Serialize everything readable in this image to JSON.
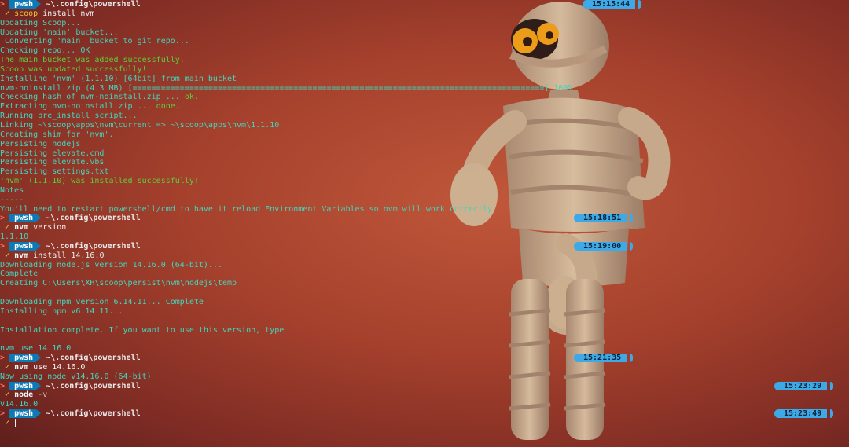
{
  "terminal": {
    "prompt_arrow": ">",
    "prompt_shell": "pwsh",
    "prompt_path": "~\\.config\\powershell",
    "check_mark": "✓",
    "blocks": [
      {
        "time": "15:15:44",
        "command": [
          {
            "text": "scoop",
            "cls": "c-yellow"
          },
          {
            "text": " install nvm",
            "cls": "c-white"
          }
        ],
        "output": [
          [
            {
              "text": "Updating Scoop...",
              "cls": "c-teal"
            }
          ],
          [
            {
              "text": "Updating 'main' bucket...",
              "cls": "c-teal"
            }
          ],
          [
            {
              "text": " Converting 'main' bucket to git repo...",
              "cls": "c-teal"
            }
          ],
          [
            {
              "text": "Checking repo... OK",
              "cls": "c-teal"
            }
          ],
          [
            {
              "text": "The main bucket was added successfully.",
              "cls": "c-green"
            }
          ],
          [
            {
              "text": "Scoop was updated successfully!",
              "cls": "c-green"
            }
          ],
          [
            {
              "text": "Installing 'nvm' (1.1.10) [64bit] from main bucket",
              "cls": "c-teal"
            }
          ],
          [
            {
              "text": "nvm-noinstall.zip (4.3 MB) [=======================================================================================] 100%",
              "cls": "c-teal"
            }
          ],
          [
            {
              "text": "Checking hash of nvm-noinstall.zip ... ",
              "cls": "c-teal"
            },
            {
              "text": "ok.",
              "cls": "c-green"
            }
          ],
          [
            {
              "text": "Extracting nvm-noinstall.zip ... ",
              "cls": "c-teal"
            },
            {
              "text": "done.",
              "cls": "c-green"
            }
          ],
          [
            {
              "text": "Running pre_install script...",
              "cls": "c-teal"
            }
          ],
          [
            {
              "text": "Linking ~\\scoop\\apps\\nvm\\current => ~\\scoop\\apps\\nvm\\1.1.10",
              "cls": "c-teal"
            }
          ],
          [
            {
              "text": "Creating shim for 'nvm'.",
              "cls": "c-teal"
            }
          ],
          [
            {
              "text": "Persisting nodejs",
              "cls": "c-teal"
            }
          ],
          [
            {
              "text": "Persisting elevate.cmd",
              "cls": "c-teal"
            }
          ],
          [
            {
              "text": "Persisting elevate.vbs",
              "cls": "c-teal"
            }
          ],
          [
            {
              "text": "Persisting settings.txt",
              "cls": "c-teal"
            }
          ],
          [
            {
              "text": "'nvm' (1.1.10) was installed successfully!",
              "cls": "c-green"
            }
          ],
          [
            {
              "text": "Notes",
              "cls": "c-teal"
            }
          ],
          [
            {
              "text": "-----",
              "cls": "c-teal"
            }
          ],
          [
            {
              "text": "You'll need to restart powershell/cmd to have it reload Environment Variables so nvm will work correctly",
              "cls": "c-teal"
            }
          ]
        ]
      },
      {
        "time": "15:18:51",
        "command": [
          {
            "text": "nvm",
            "cls": "c-bright"
          },
          {
            "text": " version",
            "cls": "c-white"
          }
        ],
        "output": [
          [
            {
              "text": "1.1.10",
              "cls": "c-teal"
            }
          ]
        ]
      },
      {
        "time": "15:19:00",
        "command": [
          {
            "text": "nvm",
            "cls": "c-bright"
          },
          {
            "text": " install 14.16.0",
            "cls": "c-white"
          }
        ],
        "output": [
          [
            {
              "text": "Downloading node.js version 14.16.0 (64-bit)...",
              "cls": "c-teal"
            }
          ],
          [
            {
              "text": "Complete",
              "cls": "c-teal"
            }
          ],
          [
            {
              "text": "Creating C:\\Users\\XH\\scoop\\persist\\nvm\\nodejs\\temp",
              "cls": "c-teal"
            }
          ],
          [
            {
              "text": "",
              "cls": "c-teal"
            }
          ],
          [
            {
              "text": "Downloading npm version 6.14.11... Complete",
              "cls": "c-teal"
            }
          ],
          [
            {
              "text": "Installing npm v6.14.11...",
              "cls": "c-teal"
            }
          ],
          [
            {
              "text": "",
              "cls": "c-teal"
            }
          ],
          [
            {
              "text": "Installation complete. If you want to use this version, type",
              "cls": "c-teal"
            }
          ],
          [
            {
              "text": "",
              "cls": "c-teal"
            }
          ],
          [
            {
              "text": "nvm use 14.16.0",
              "cls": "c-teal"
            }
          ]
        ]
      },
      {
        "time": "15:21:35",
        "command": [
          {
            "text": "nvm",
            "cls": "c-bright"
          },
          {
            "text": " use 14.16.0",
            "cls": "c-white"
          }
        ],
        "output": [
          [
            {
              "text": "Now using node v14.16.0 (64-bit)",
              "cls": "c-teal"
            }
          ]
        ]
      },
      {
        "time": "15:23:29",
        "command": [
          {
            "text": "node",
            "cls": "c-bright"
          },
          {
            "text": " -v",
            "cls": "c-muted"
          }
        ],
        "output": [
          [
            {
              "text": "v14.16.0",
              "cls": "c-teal"
            }
          ]
        ]
      },
      {
        "time": "15:23:49",
        "command": [],
        "cursor": true,
        "output": []
      }
    ]
  }
}
